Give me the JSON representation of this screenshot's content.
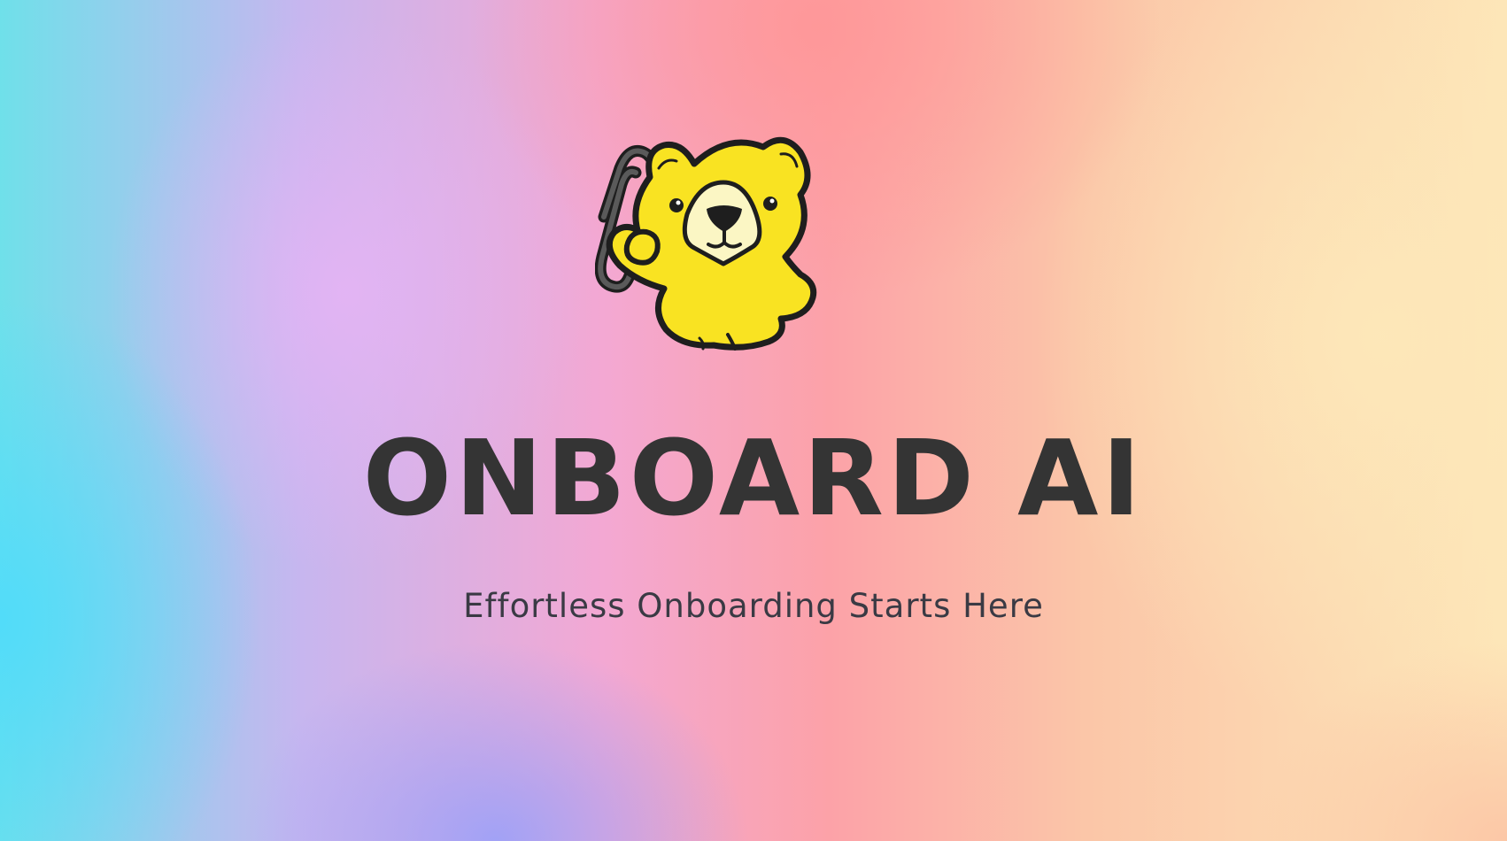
{
  "hero": {
    "title": "ONBOARD AI",
    "tagline": "Effortless Onboarding Starts Here",
    "mascot_icon": "bear-holding-paperclip-icon"
  },
  "colors": {
    "title_text": "#343434",
    "tagline_text": "#3a3a44",
    "mascot_body": "#f9e322",
    "mascot_outline": "#1e1e1e",
    "mascot_muzzle": "#fbf6c4",
    "background_left": "#5edcf5",
    "background_center": "#fca2a8",
    "background_right": "#fde6b8"
  }
}
